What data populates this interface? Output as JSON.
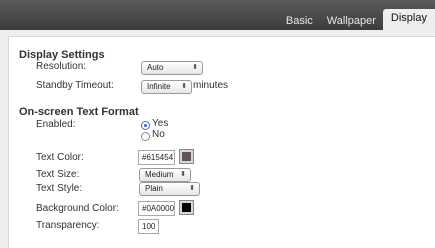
{
  "tabs": [
    {
      "label": "Basic"
    },
    {
      "label": "Wallpaper"
    },
    {
      "label": "Display"
    }
  ],
  "display_settings": {
    "title": "Display Settings",
    "resolution": {
      "label": "Resolution:",
      "value": "Auto"
    },
    "standby": {
      "label": "Standby Timeout:",
      "value": "Infinite",
      "suffix": "minutes"
    }
  },
  "text_format": {
    "title": "On-screen Text Format",
    "enabled": {
      "label": "Enabled:",
      "yes": "Yes",
      "no": "No",
      "selected": "Yes"
    },
    "text_color": {
      "label": "Text Color:",
      "value": "#615454",
      "swatch": "#615454"
    },
    "text_size": {
      "label": "Text Size:",
      "value": "Medium"
    },
    "text_style": {
      "label": "Text Style:",
      "value": "Plain"
    },
    "background_color": {
      "label": "Background Color:",
      "value": "#0A0000",
      "swatch": "#0A0000"
    },
    "transparency": {
      "label": "Transparency:",
      "value": "100"
    }
  },
  "icons": {
    "select_arrows": "up-down-arrows-icon"
  }
}
